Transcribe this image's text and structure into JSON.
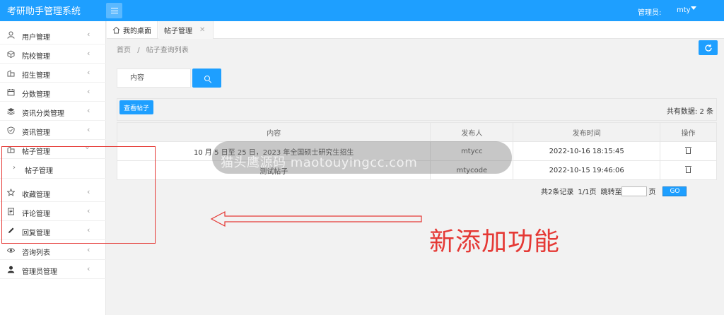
{
  "app": {
    "title": "考研助手管理系统"
  },
  "header": {
    "admin_label": "管理员:",
    "admin_name": "mty"
  },
  "sidebar": {
    "items": [
      {
        "label": "用户管理",
        "icon": "user-icon"
      },
      {
        "label": "院校管理",
        "icon": "cube-icon"
      },
      {
        "label": "招生管理",
        "icon": "building-icon"
      },
      {
        "label": "分数管理",
        "icon": "calendar-icon"
      },
      {
        "label": "资讯分类管理",
        "icon": "layers-icon"
      },
      {
        "label": "资讯管理",
        "icon": "shield-icon"
      },
      {
        "label": "帖子管理",
        "icon": "building-icon",
        "expanded": true
      },
      {
        "label": "帖子管理",
        "sub": true
      },
      {
        "label": "收藏管理",
        "icon": "star-icon"
      },
      {
        "label": "评论管理",
        "icon": "form-icon"
      },
      {
        "label": "回复管理",
        "icon": "pencil-icon"
      },
      {
        "label": "咨询列表",
        "icon": "eye-icon"
      },
      {
        "label": "管理员管理",
        "icon": "person-icon"
      }
    ]
  },
  "tabs": [
    {
      "label": "我的桌面",
      "icon": "home-icon"
    },
    {
      "label": "帖子管理",
      "active": true
    }
  ],
  "breadcrumb": {
    "home": "首页",
    "separator": "/",
    "current": "帖子查询列表"
  },
  "search": {
    "placeholder": "内容"
  },
  "toolbar": {
    "view_button": "查看帖子",
    "total_label": "共有数据:",
    "total_count": "2 条"
  },
  "table": {
    "headers": [
      "内容",
      "发布人",
      "发布时间",
      "操作"
    ],
    "rows": [
      {
        "content": "10 月 5 日至 25 日，2023 年全国硕士研究生招生",
        "author": "mtycc",
        "time": "2022-10-16 18:15:45"
      },
      {
        "content": "测试帖子",
        "author": "mtycode",
        "time": "2022-10-15 19:46:06"
      }
    ]
  },
  "pager": {
    "records": "共2条记录",
    "pages": "1/1页",
    "jump_label": "跳转至",
    "page_unit": "页",
    "go": "GO"
  },
  "watermark": {
    "text": "猫头鹰源码 maotouyingcc.com"
  },
  "annotation": {
    "text": "新添加功能"
  },
  "colors": {
    "primary": "#1E9FFF",
    "annotation_red": "#e53935"
  }
}
